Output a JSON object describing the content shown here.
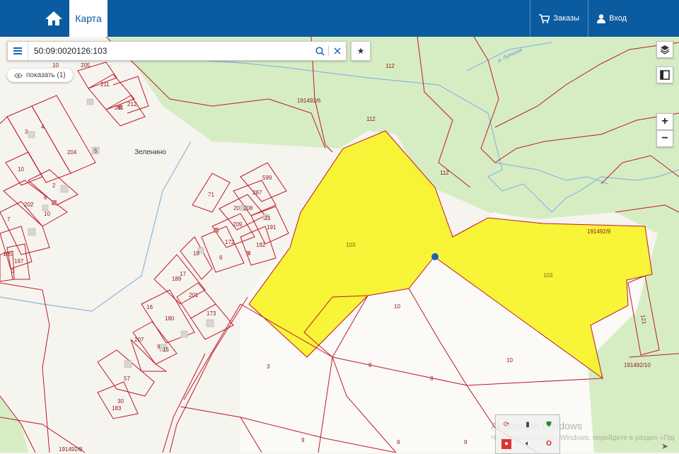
{
  "header": {
    "tab_label": "Карта",
    "orders_label": "Заказы",
    "login_label": "Вход",
    "icons": {
      "home": "home-icon",
      "cart": "cart-icon",
      "user": "user-icon"
    },
    "colors": {
      "bar": "#0a5ba0"
    }
  },
  "search": {
    "value": "50:09:0020126:103",
    "placeholder": ""
  },
  "show_chip": {
    "label": "показать (1)"
  },
  "map": {
    "place_name": "Зеленино",
    "river_name": "р. Лутосня",
    "selected_parcel_label": "103",
    "colors": {
      "selection": "#f7f31e",
      "boundary": "#c0182a",
      "forest": "#d6edc4",
      "water": "#8ab7e0"
    },
    "parcel_labels": [
      "205",
      "211",
      "212",
      "211",
      "10",
      "3",
      "4",
      "204",
      "5",
      "10",
      "2",
      "8",
      "202",
      "10",
      "7",
      "195",
      "197",
      "3",
      "71",
      "599",
      "287",
      "208",
      "20",
      "21",
      "191",
      "209",
      "172",
      "6",
      "192",
      "18",
      "189",
      "17",
      "201",
      "173",
      "16",
      "180",
      "207",
      "9",
      "15",
      "57",
      "30",
      "183",
      "191492/6",
      "112",
      "112",
      "112",
      "191492/9",
      "121",
      "191492/10",
      "10",
      "10",
      "3",
      "8",
      "8",
      "9",
      "9",
      "191492/8",
      "9"
    ]
  },
  "controls": {
    "zoom_in": "+",
    "zoom_out": "−"
  },
  "watermark": {
    "line1": "Активация Windows",
    "line2": "Чтобы активировать Windows, перейдите в раздел «Параметры»."
  }
}
